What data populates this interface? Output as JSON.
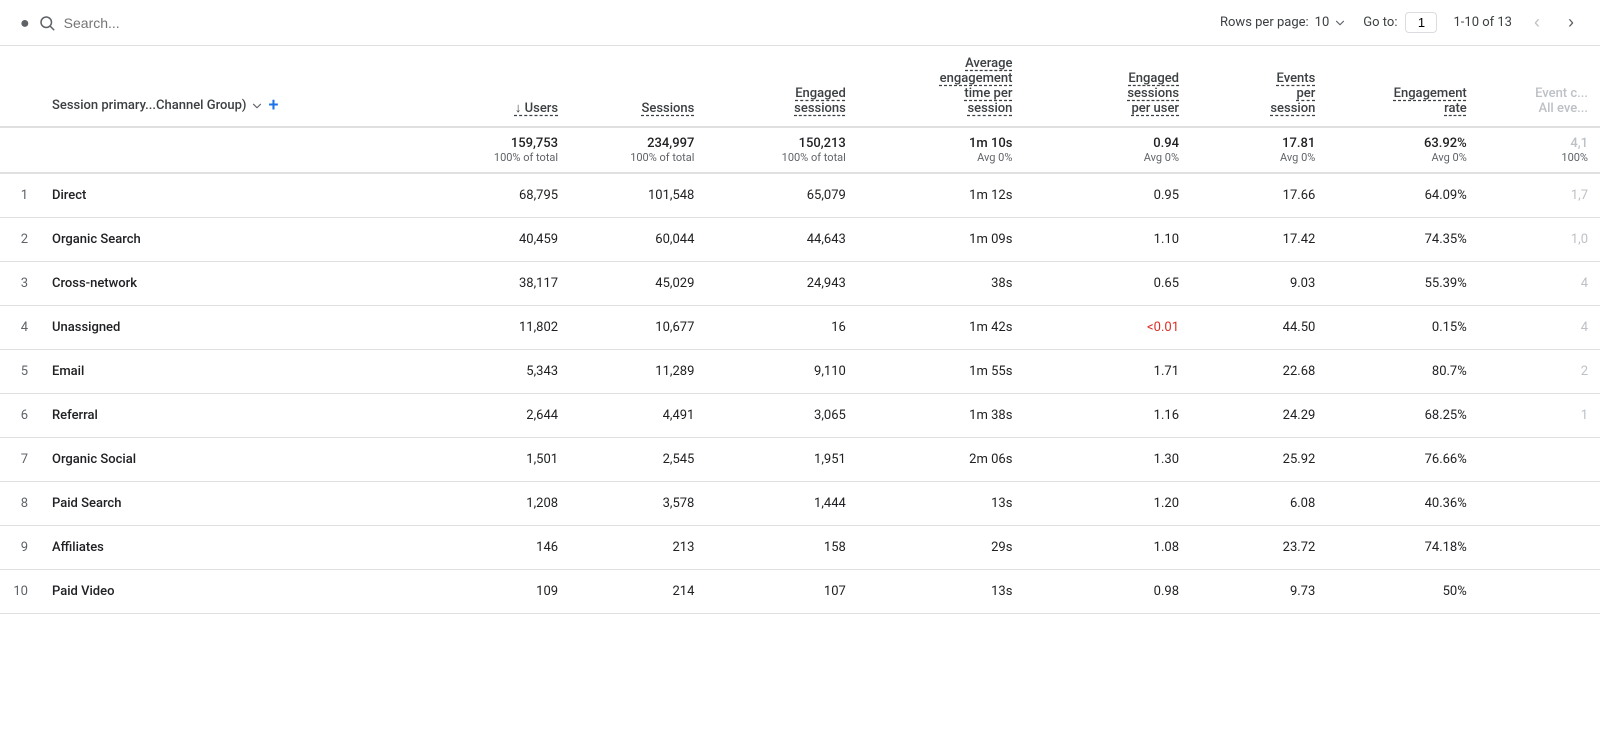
{
  "topbar": {
    "search_placeholder": "Search...",
    "rows_per_page_label": "Rows per page:",
    "rows_per_page_value": "10",
    "goto_label": "Go to:",
    "goto_value": "1",
    "page_info": "1-10 of 13"
  },
  "table": {
    "dimension_col": "Session primary...Channel Group)",
    "columns": [
      {
        "id": "users",
        "label": "↓ Users",
        "underline": true
      },
      {
        "id": "sessions",
        "label": "Sessions",
        "underline": true
      },
      {
        "id": "engaged_sessions",
        "label": "Engaged sessions",
        "multiline": true,
        "underline": true
      },
      {
        "id": "avg_engagement",
        "label": "Average engagement time per session",
        "multiline": true,
        "underline": true
      },
      {
        "id": "engaged_per_user",
        "label": "Engaged sessions per user",
        "multiline": true,
        "underline": true
      },
      {
        "id": "events_per_session",
        "label": "Events per session",
        "multiline": true,
        "underline": true
      },
      {
        "id": "engagement_rate",
        "label": "Engagement rate",
        "multiline": true,
        "underline": true
      },
      {
        "id": "event_count",
        "label": "Event c... All eve...",
        "multiline": false,
        "underline": false,
        "fade": true
      }
    ],
    "totals": {
      "users": "159,753",
      "users_sub": "100% of total",
      "sessions": "234,997",
      "sessions_sub": "100% of total",
      "engaged_sessions": "150,213",
      "engaged_sessions_sub": "100% of total",
      "avg_engagement": "1m 10s",
      "avg_engagement_sub": "Avg 0%",
      "engaged_per_user": "0.94",
      "engaged_per_user_sub": "Avg 0%",
      "events_per_session": "17.81",
      "events_per_session_sub": "Avg 0%",
      "engagement_rate": "63.92%",
      "engagement_rate_sub": "Avg 0%",
      "event_count": "4,1",
      "event_count_sub": "100%"
    },
    "rows": [
      {
        "num": "1",
        "channel": "Direct",
        "users": "68,795",
        "sessions": "101,548",
        "engaged_sessions": "65,079",
        "avg_engagement": "1m 12s",
        "engaged_per_user": "0.95",
        "events_per_session": "17.66",
        "engagement_rate": "64.09%",
        "event_count": "1,7"
      },
      {
        "num": "2",
        "channel": "Organic Search",
        "users": "40,459",
        "sessions": "60,044",
        "engaged_sessions": "44,643",
        "avg_engagement": "1m 09s",
        "engaged_per_user": "1.10",
        "events_per_session": "17.42",
        "engagement_rate": "74.35%",
        "event_count": "1,0"
      },
      {
        "num": "3",
        "channel": "Cross-network",
        "users": "38,117",
        "sessions": "45,029",
        "engaged_sessions": "24,943",
        "avg_engagement": "38s",
        "engaged_per_user": "0.65",
        "events_per_session": "9.03",
        "engagement_rate": "55.39%",
        "event_count": "4"
      },
      {
        "num": "4",
        "channel": "Unassigned",
        "users": "11,802",
        "sessions": "10,677",
        "engaged_sessions": "16",
        "avg_engagement": "1m 42s",
        "engaged_per_user": "<0.01",
        "events_per_session": "44.50",
        "engagement_rate": "0.15%",
        "event_count": "4",
        "highlight_engaged_per_user": true
      },
      {
        "num": "5",
        "channel": "Email",
        "users": "5,343",
        "sessions": "11,289",
        "engaged_sessions": "9,110",
        "avg_engagement": "1m 55s",
        "engaged_per_user": "1.71",
        "events_per_session": "22.68",
        "engagement_rate": "80.7%",
        "event_count": "2"
      },
      {
        "num": "6",
        "channel": "Referral",
        "users": "2,644",
        "sessions": "4,491",
        "engaged_sessions": "3,065",
        "avg_engagement": "1m 38s",
        "engaged_per_user": "1.16",
        "events_per_session": "24.29",
        "engagement_rate": "68.25%",
        "event_count": "1"
      },
      {
        "num": "7",
        "channel": "Organic Social",
        "users": "1,501",
        "sessions": "2,545",
        "engaged_sessions": "1,951",
        "avg_engagement": "2m 06s",
        "engaged_per_user": "1.30",
        "events_per_session": "25.92",
        "engagement_rate": "76.66%",
        "event_count": ""
      },
      {
        "num": "8",
        "channel": "Paid Search",
        "users": "1,208",
        "sessions": "3,578",
        "engaged_sessions": "1,444",
        "avg_engagement": "13s",
        "engaged_per_user": "1.20",
        "events_per_session": "6.08",
        "engagement_rate": "40.36%",
        "event_count": ""
      },
      {
        "num": "9",
        "channel": "Affiliates",
        "users": "146",
        "sessions": "213",
        "engaged_sessions": "158",
        "avg_engagement": "29s",
        "engaged_per_user": "1.08",
        "events_per_session": "23.72",
        "engagement_rate": "74.18%",
        "event_count": ""
      },
      {
        "num": "10",
        "channel": "Paid Video",
        "users": "109",
        "sessions": "214",
        "engaged_sessions": "107",
        "avg_engagement": "13s",
        "engaged_per_user": "0.98",
        "events_per_session": "9.73",
        "engagement_rate": "50%",
        "event_count": ""
      }
    ]
  }
}
